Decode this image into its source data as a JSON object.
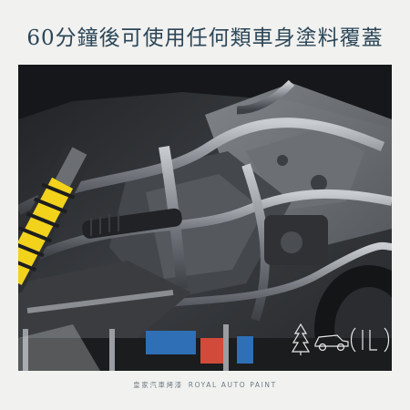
{
  "headline": "60分鐘後可使用任何類車身塗料覆蓋",
  "footer": {
    "brand_cn": "皇家汽車烤漆",
    "brand_en": "ROYAL AUTO PAINT"
  },
  "colors": {
    "page_background": "#f1f1ef",
    "headline_text": "#2b4658",
    "footer_text": "#6f7a82",
    "spring_yellow": "#f2d21b"
  }
}
